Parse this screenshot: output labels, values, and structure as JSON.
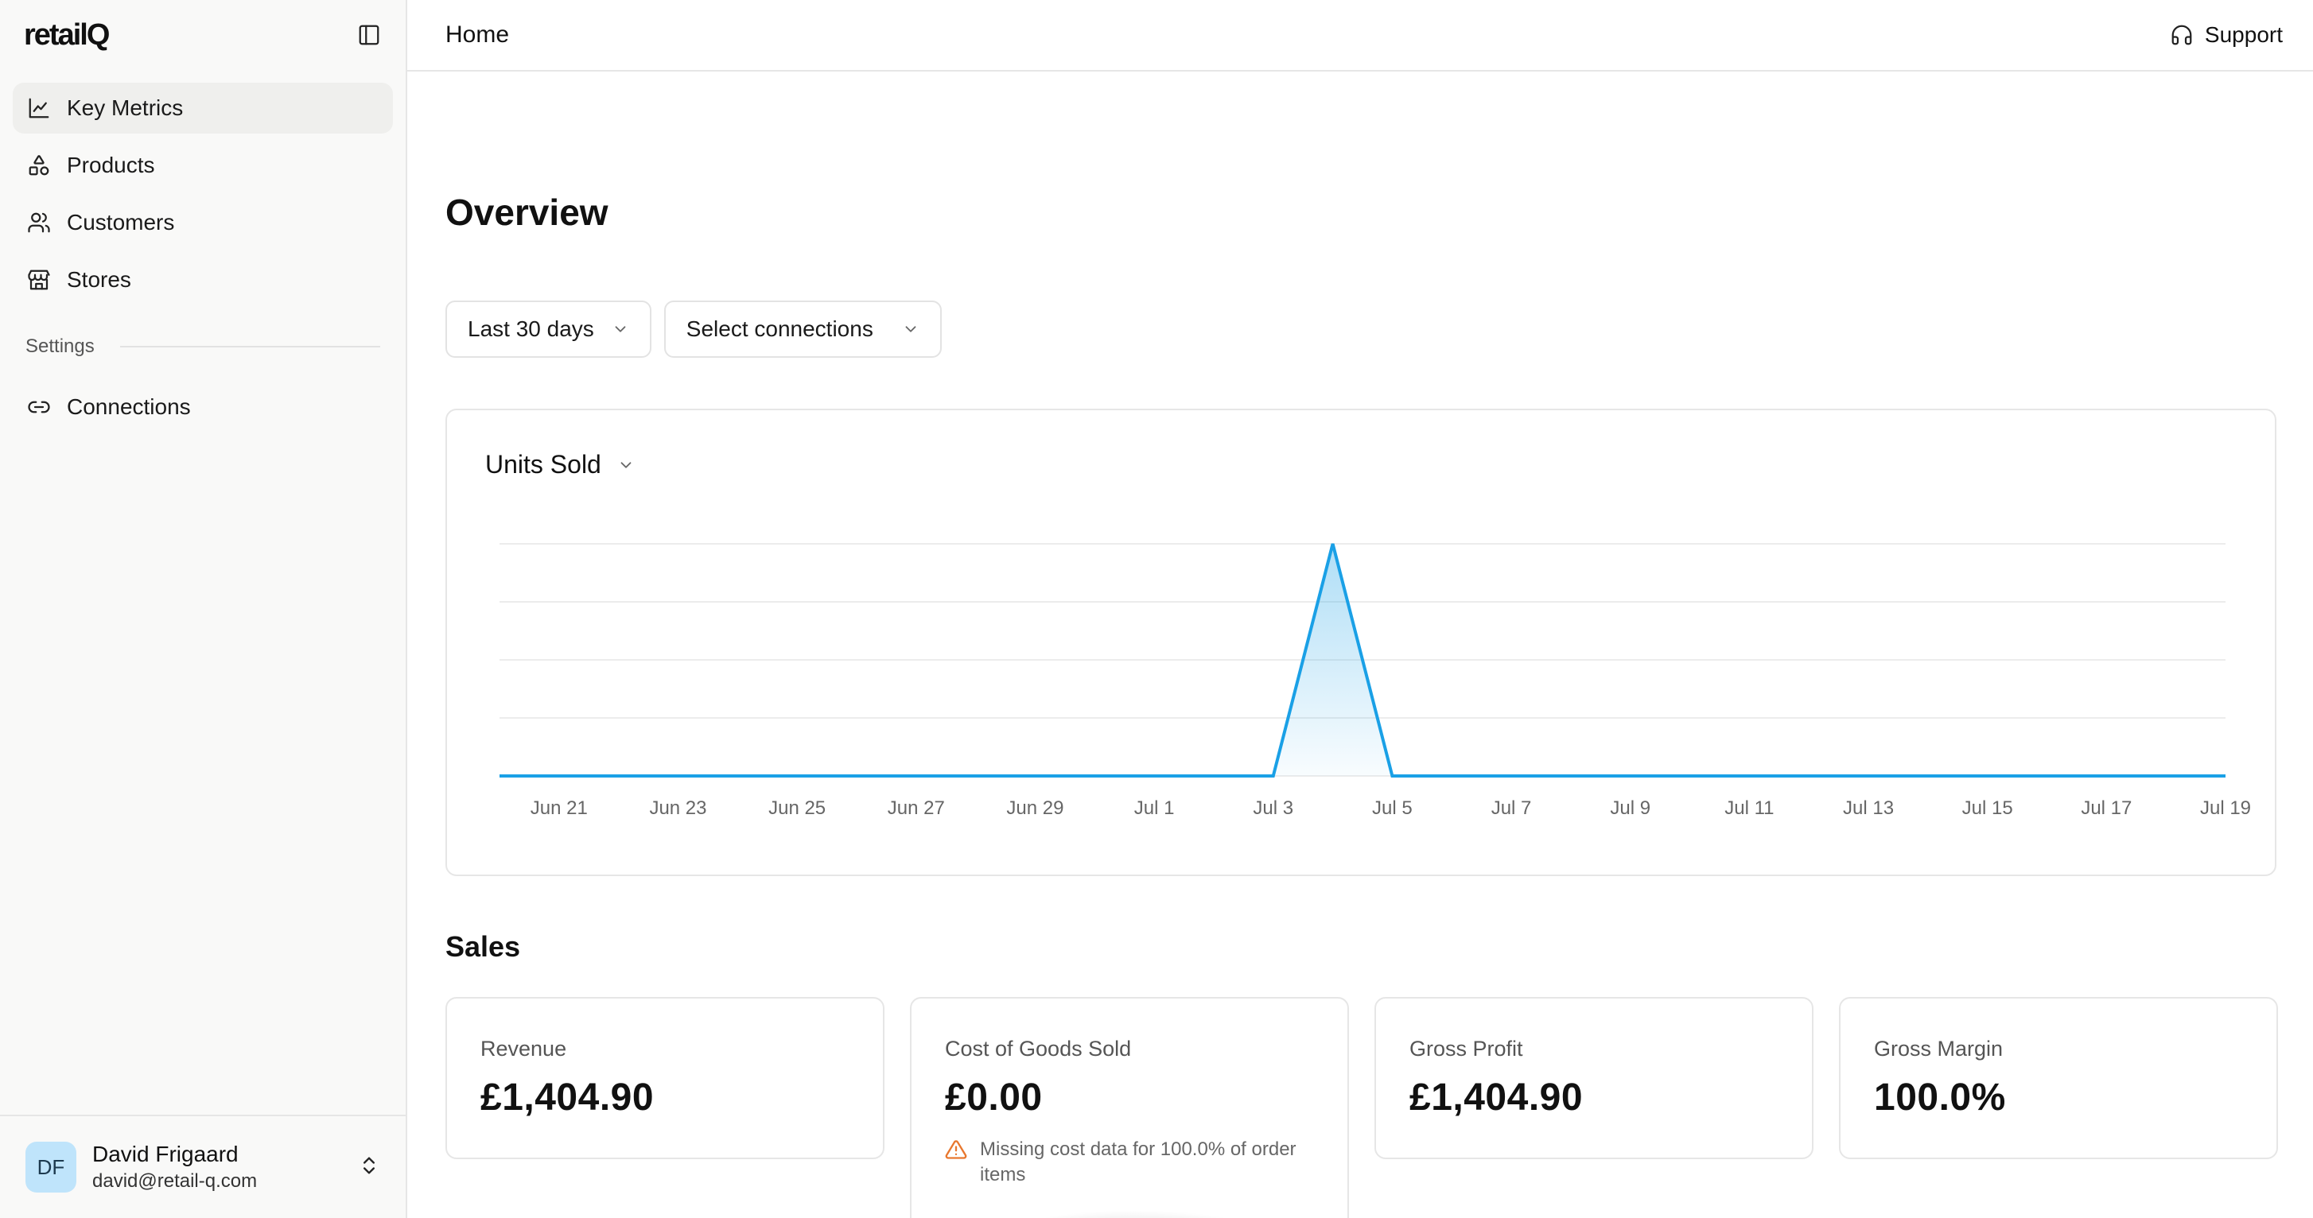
{
  "app": {
    "logo": "retailQ"
  },
  "sidebar": {
    "items": [
      {
        "label": "Key Metrics",
        "icon": "line-chart-icon",
        "active": true
      },
      {
        "label": "Products",
        "icon": "shapes-icon"
      },
      {
        "label": "Customers",
        "icon": "users-icon"
      },
      {
        "label": "Stores",
        "icon": "store-icon"
      }
    ],
    "settings_label": "Settings",
    "settings_items": [
      {
        "label": "Connections",
        "icon": "link-icon"
      }
    ],
    "user": {
      "initials": "DF",
      "name": "David Frigaard",
      "email": "david@retail-q.com"
    }
  },
  "topbar": {
    "title": "Home",
    "support_label": "Support"
  },
  "overview": {
    "title": "Overview",
    "filters": {
      "date_range": "Last 30 days",
      "connections": "Select connections"
    }
  },
  "chart": {
    "metric_label": "Units Sold"
  },
  "chart_data": {
    "type": "area",
    "title": "",
    "xlabel": "",
    "ylabel": "",
    "x_ticks": [
      "Jun 21",
      "Jun 23",
      "Jun 25",
      "Jun 27",
      "Jun 29",
      "Jul 1",
      "Jul 3",
      "Jul 5",
      "Jul 7",
      "Jul 9",
      "Jul 11",
      "Jul 13",
      "Jul 15",
      "Jul 17",
      "Jul 19"
    ],
    "x": [
      "Jun 20",
      "Jun 21",
      "Jun 22",
      "Jun 23",
      "Jun 24",
      "Jun 25",
      "Jun 26",
      "Jun 27",
      "Jun 28",
      "Jun 29",
      "Jun 30",
      "Jul 1",
      "Jul 2",
      "Jul 3",
      "Jul 4",
      "Jul 5",
      "Jul 6",
      "Jul 7",
      "Jul 8",
      "Jul 9",
      "Jul 10",
      "Jul 11",
      "Jul 12",
      "Jul 13",
      "Jul 14",
      "Jul 15",
      "Jul 16",
      "Jul 17",
      "Jul 18",
      "Jul 19"
    ],
    "series": [
      {
        "values": [
          0,
          0,
          0,
          0,
          0,
          0,
          0,
          0,
          0,
          0,
          0,
          0,
          0,
          0,
          4,
          0,
          0,
          0,
          0,
          0,
          0,
          0,
          0,
          0,
          0,
          0,
          0,
          0,
          0,
          0
        ]
      }
    ],
    "ylim": [
      0,
      4
    ],
    "y_gridlines": 4,
    "grid": true,
    "legend": "none",
    "line_color": "#1aa0e6"
  },
  "sales": {
    "title": "Sales",
    "cards": [
      {
        "label": "Revenue",
        "value": "£1,404.90"
      },
      {
        "label": "Cost of Goods Sold",
        "value": "£0.00",
        "note": "Missing cost data for 100.0% of order items"
      },
      {
        "label": "Gross Profit",
        "value": "£1,404.90"
      },
      {
        "label": "Gross Margin",
        "value": "100.0%"
      }
    ]
  },
  "colors": {
    "accent": "#1aa0e6",
    "warning": "#e8772e",
    "avatar_bg": "#bfe4fb"
  }
}
